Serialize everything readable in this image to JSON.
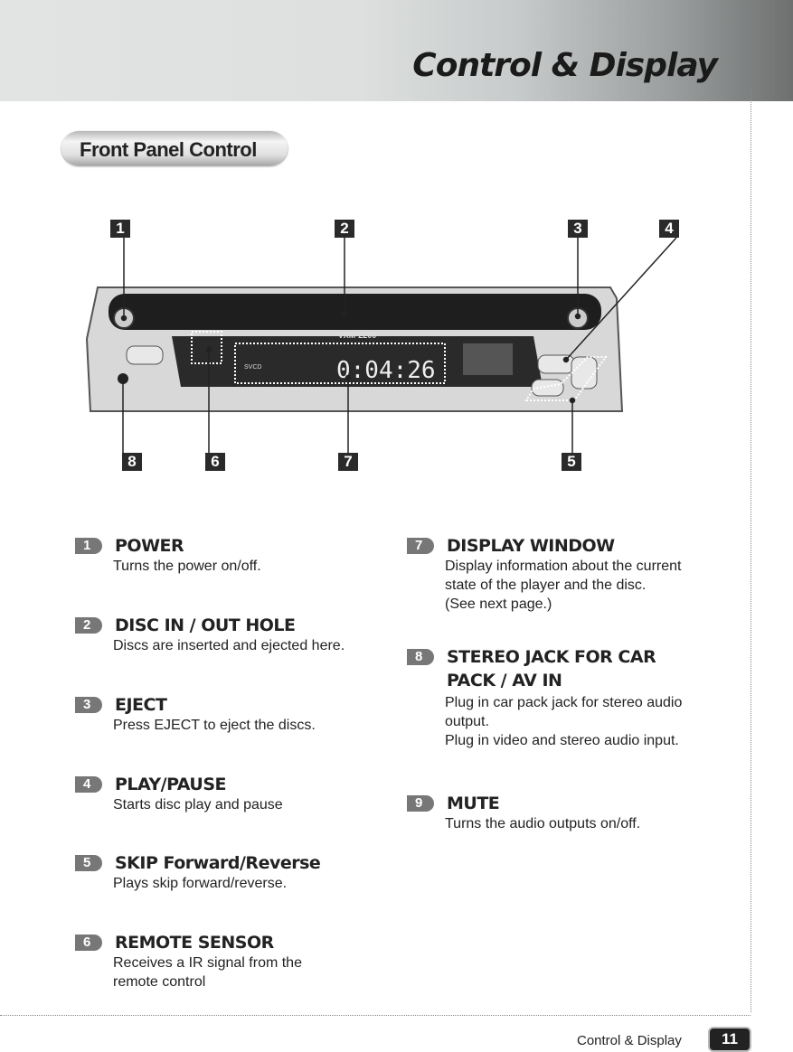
{
  "header": {
    "title": "Control & Display"
  },
  "section": {
    "title": "Front Panel Control"
  },
  "figure": {
    "callouts_top": [
      "1",
      "2",
      "3",
      "4"
    ],
    "callouts_bottom": [
      "8",
      "6",
      "7",
      "5"
    ],
    "display_time": "0:04:26",
    "model": "VXM-2200",
    "display_mode": "SVCD"
  },
  "items": [
    {
      "num": "1",
      "title": "POWER",
      "desc": [
        "Turns the power on/off."
      ]
    },
    {
      "num": "2",
      "title": "DISC IN / OUT HOLE",
      "desc": [
        "Discs are inserted and ejected here."
      ]
    },
    {
      "num": "3",
      "title": "EJECT",
      "desc": [
        "Press EJECT to eject the discs."
      ]
    },
    {
      "num": "4",
      "title": "PLAY/PAUSE",
      "desc": [
        "Starts disc play and pause"
      ]
    },
    {
      "num": "5",
      "title": "SKIP Forward/Reverse",
      "desc": [
        "Plays skip forward/reverse."
      ]
    },
    {
      "num": "6",
      "title": "REMOTE SENSOR",
      "desc": [
        "Receives a IR signal from the",
        "remote control"
      ]
    },
    {
      "num": "7",
      "title": "DISPLAY WINDOW",
      "desc": [
        "Display information about the current",
        "state of the player and the disc.",
        "(See next page.)"
      ]
    },
    {
      "num": "8",
      "title": "STEREO JACK FOR CAR",
      "title2": "PACK / AV IN",
      "desc": [
        "Plug in car pack jack for stereo audio",
        "output.",
        "Plug in video and stereo audio input."
      ]
    },
    {
      "num": "9",
      "title": "MUTE",
      "desc": [
        "Turns the audio outputs on/off."
      ]
    }
  ],
  "footer": {
    "label": "Control & Display",
    "page": "11"
  }
}
